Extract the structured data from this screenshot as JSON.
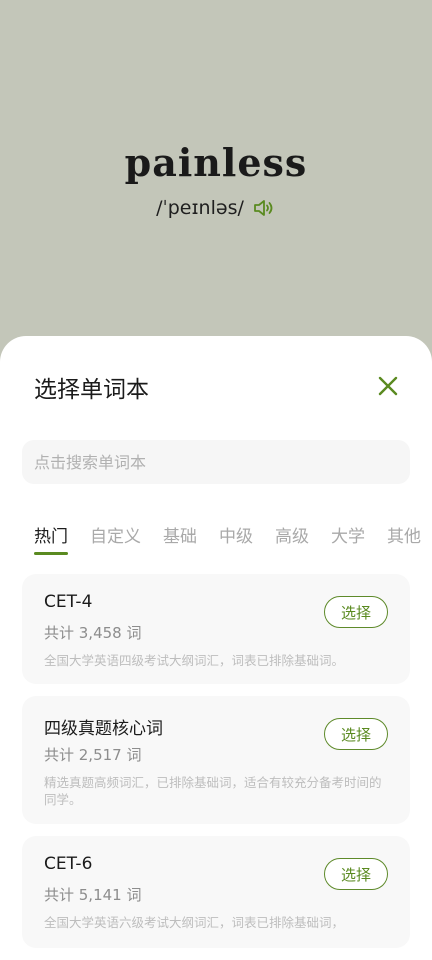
{
  "word": {
    "text": "painless",
    "phonetic": "/ˈpeɪnləs/",
    "speaker_icon": "speaker-icon"
  },
  "sheet": {
    "title": "选择单词本",
    "close_icon": "close-icon",
    "search_placeholder": "点击搜索单词本",
    "tabs": [
      "热门",
      "自定义",
      "基础",
      "中级",
      "高级",
      "大学",
      "其他"
    ],
    "active_tab": "热门",
    "books": [
      {
        "title": "CET-4",
        "count": "共计 3,458 词",
        "desc": "全国大学英语四级考试大纲词汇，词表已排除基础词。",
        "button": "选择"
      },
      {
        "title": "四级真题核心词",
        "count": "共计 2,517 词",
        "desc": "精选真题高频词汇，已排除基础词，适合有较充分备考时间的同学。",
        "button": "选择"
      },
      {
        "title": "CET-6",
        "count": "共计 5,141 词",
        "desc": "全国大学英语六级考试大纲词汇，词表已排除基础词，",
        "button": "选择"
      }
    ]
  },
  "colors": {
    "background": "#c3c6b9",
    "accent": "#5a8a20"
  }
}
